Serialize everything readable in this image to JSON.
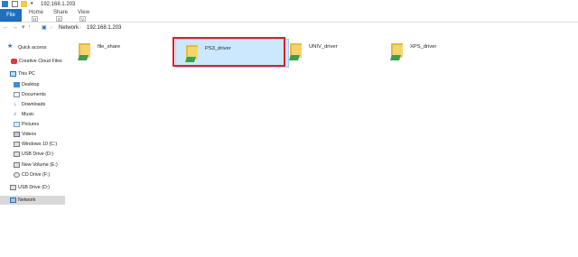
{
  "titlebar": {
    "path": "192.168.1.203"
  },
  "ribbon": {
    "file": "File",
    "tabs": [
      {
        "label": "Home",
        "key": "H"
      },
      {
        "label": "Share",
        "key": "S"
      },
      {
        "label": "View",
        "key": "V"
      }
    ]
  },
  "address": {
    "crumbs": [
      "Network",
      "192.168.1.203"
    ]
  },
  "sidebar": {
    "items": [
      {
        "label": "Quick access",
        "icon": "star-icon"
      },
      {
        "label": "Creative Cloud Files",
        "icon": "creative-cloud-icon"
      },
      {
        "label": "This PC",
        "icon": "computer-icon"
      },
      {
        "label": "Desktop",
        "icon": "desktop-icon"
      },
      {
        "label": "Documents",
        "icon": "documents-icon"
      },
      {
        "label": "Downloads",
        "icon": "downloads-icon"
      },
      {
        "label": "Music",
        "icon": "music-icon"
      },
      {
        "label": "Pictures",
        "icon": "pictures-icon"
      },
      {
        "label": "Videos",
        "icon": "videos-icon"
      },
      {
        "label": "Windows 10 (C:)",
        "icon": "drive-icon"
      },
      {
        "label": "USB Drive (D:)",
        "icon": "drive-icon"
      },
      {
        "label": "New Volume (E:)",
        "icon": "drive-icon"
      },
      {
        "label": "CD Drive (F:)",
        "icon": "cd-drive-icon"
      },
      {
        "label": "USB Drive (D:)",
        "icon": "drive-icon"
      },
      {
        "label": "Network",
        "icon": "network-icon"
      }
    ]
  },
  "folders": [
    {
      "label": "file_share",
      "icon": "shared-folder-icon"
    },
    {
      "label": "PS3_driver",
      "icon": "shared-folder-icon"
    },
    {
      "label": "UNIV_driver",
      "icon": "shared-folder-icon"
    },
    {
      "label": "XPS_driver",
      "icon": "shared-folder-icon"
    }
  ],
  "colors": {
    "accent": "#1e6fbf",
    "selection": "#cce8ff",
    "highlight_box": "#d6212b"
  }
}
